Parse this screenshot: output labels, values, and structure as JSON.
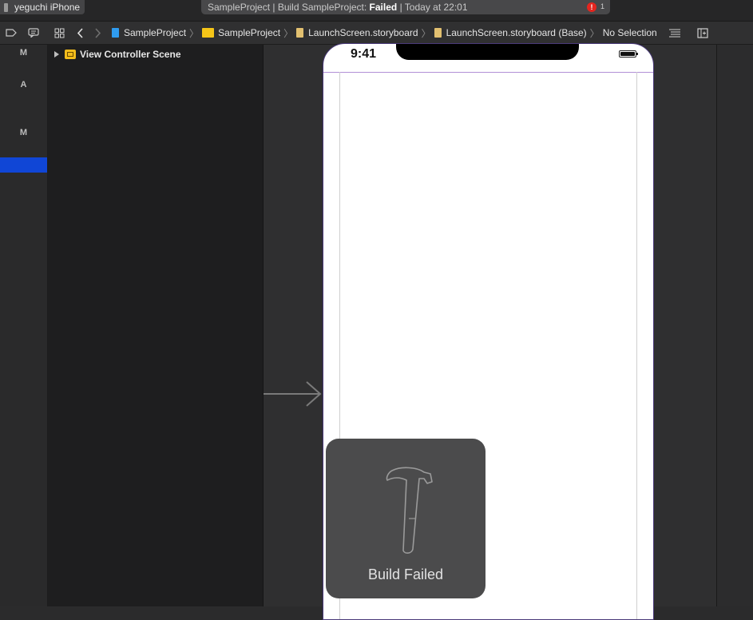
{
  "scheme": {
    "device": "yeguchi iPhone"
  },
  "activity": {
    "prefix": "SampleProject | Build SampleProject: ",
    "result": "Failed",
    "suffix": " | Today at 22:01",
    "error_count": "1"
  },
  "jumpbar": {
    "crumbs": [
      "SampleProject",
      "SampleProject",
      "LaunchScreen.storyboard",
      "LaunchScreen.storyboard (Base)",
      "No Selection"
    ]
  },
  "leftstrip": {
    "letters": [
      "M",
      "A",
      "M"
    ]
  },
  "outline": {
    "scene": "View Controller Scene"
  },
  "device": {
    "time": "9:41"
  },
  "hud": {
    "label": "Build Failed"
  },
  "colors": {
    "selection": "#1046d6",
    "error": "#e5251f",
    "folder": "#f5c518"
  }
}
